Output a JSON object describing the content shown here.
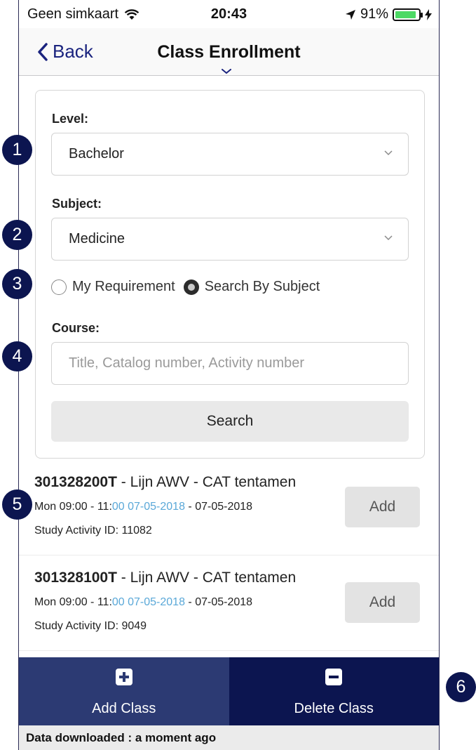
{
  "status_bar": {
    "carrier": "Geen simkaart",
    "time": "20:43",
    "battery_percent": "91%",
    "battery_level": 0.91,
    "icons": [
      "wifi-icon",
      "location-arrow-icon",
      "battery-icon",
      "charging-icon"
    ]
  },
  "nav": {
    "back_label": "Back",
    "title": "Class Enrollment"
  },
  "form": {
    "level_label": "Level:",
    "level_value": "Bachelor",
    "subject_label": "Subject:",
    "subject_value": "Medicine",
    "radio_options": [
      {
        "label": "My Requirement",
        "selected": false
      },
      {
        "label": "Search By Subject",
        "selected": true
      }
    ],
    "course_label": "Course:",
    "course_placeholder": "Title, Catalog number, Activity number",
    "course_value": "",
    "search_label": "Search"
  },
  "results": [
    {
      "code": "301328200T",
      "title_rest": " - Lijn AWV - CAT tentamen",
      "time_prefix": "Mon 09:00 - 11:",
      "time_highlight": "00 07-05-2018",
      "time_suffix": " - 07-05-2018",
      "activity_id": "Study Activity ID: 11082",
      "add_label": "Add"
    },
    {
      "code": "301328100T",
      "title_rest": " - Lijn AWV - CAT tentamen",
      "time_prefix": "Mon 09:00 - 11:",
      "time_highlight": "00 07-05-2018",
      "time_suffix": " - 07-05-2018",
      "activity_id": "Study Activity ID: 9049",
      "add_label": "Add"
    }
  ],
  "tabs": {
    "add_label": "Add Class",
    "delete_label": "Delete Class"
  },
  "footer": {
    "status_text": "Data downloaded : a moment ago"
  },
  "badges": [
    "1",
    "2",
    "3",
    "4",
    "5",
    "6"
  ],
  "colors": {
    "brand_dark": "#0c1550",
    "tab_add_bg": "#2c3a73",
    "link_blue": "#5aa8d8",
    "battery_green": "#4cd964"
  }
}
